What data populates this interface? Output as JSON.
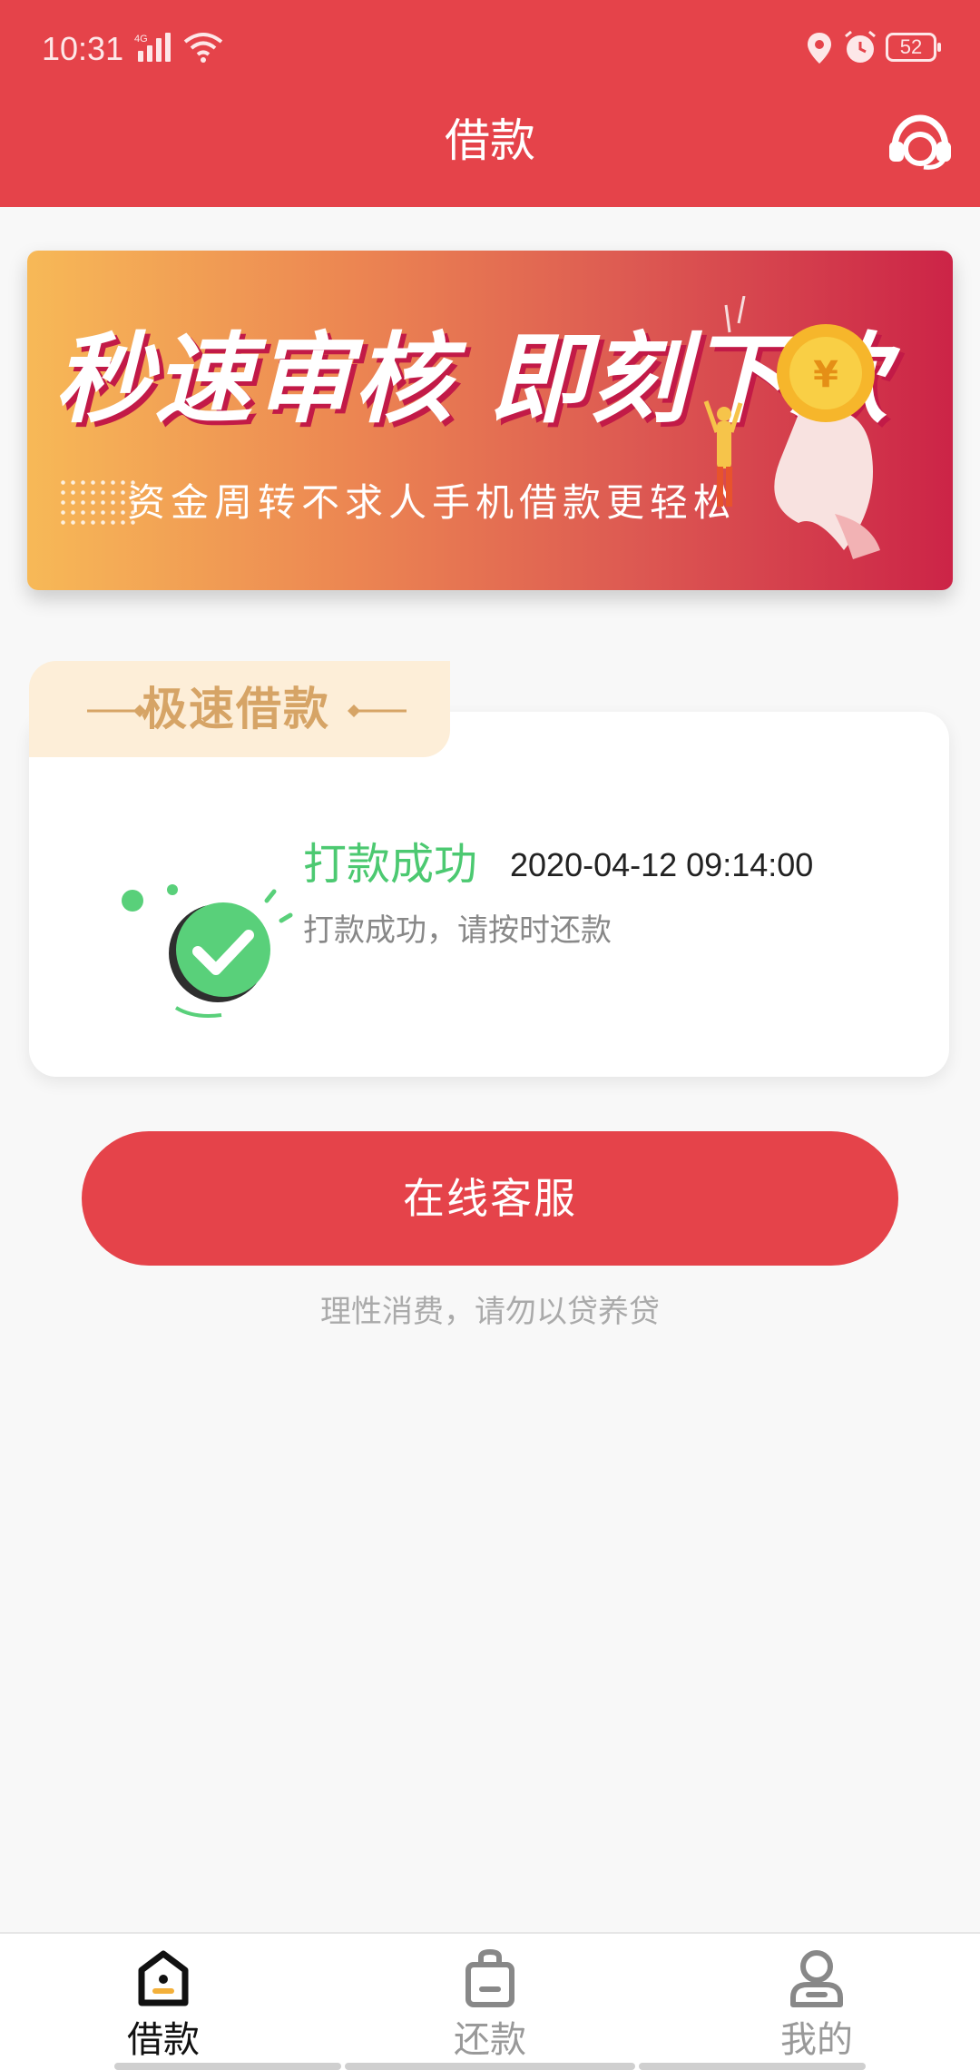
{
  "status_bar": {
    "time": "10:31",
    "network": "4G",
    "battery": "52"
  },
  "header": {
    "title": "借款",
    "support_icon": "headset-icon"
  },
  "banner": {
    "headline": "秒速审核 即刻下款",
    "subline": "资金周转不求人手机借款更轻松"
  },
  "loan_card": {
    "tab_title": "极速借款",
    "status_title": "打款成功",
    "status_time": "2020-04-12 09:14:00",
    "status_desc": "打款成功，请按时还款"
  },
  "actions": {
    "service_button": "在线客服",
    "hint": "理性消费，请勿以贷养贷"
  },
  "bottom_nav": {
    "items": [
      {
        "label": "借款",
        "icon": "home-tag-icon",
        "active": true
      },
      {
        "label": "还款",
        "icon": "bag-icon",
        "active": false
      },
      {
        "label": "我的",
        "icon": "user-icon",
        "active": false
      }
    ]
  },
  "colors": {
    "brand_red": "#e5434a",
    "success_green": "#4cc971",
    "tab_gold": "#d6a466"
  }
}
